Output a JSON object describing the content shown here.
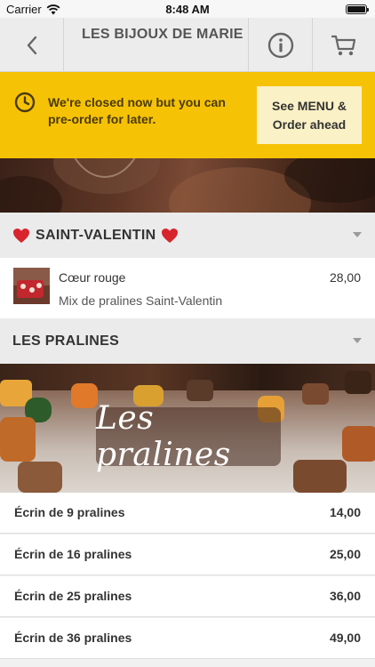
{
  "status_bar": {
    "carrier": "Carrier",
    "time": "8:48 AM"
  },
  "nav": {
    "title": "LES BIJOUX DE MARIE",
    "back_icon": "chevron-left-icon",
    "info_icon": "info-icon",
    "cart_icon": "cart-icon"
  },
  "banner": {
    "message": "We're closed now but you can pre-order for later.",
    "button_label": "See MENU & Order ahead",
    "icon": "clock-icon",
    "color": "#f6c205"
  },
  "sections": [
    {
      "title": "SAINT-VALENTIN",
      "icon": "heart-icon"
    },
    {
      "title": "LES PRALINES"
    }
  ],
  "featured_product": {
    "name": "Cœur rouge",
    "description": "Mix de pralines Saint-Valentin",
    "price": "28,00"
  },
  "praline_banner_label": "Les pralines",
  "products": [
    {
      "name": "Écrin de 9 pralines",
      "price": "14,00"
    },
    {
      "name": "Écrin de 16 pralines",
      "price": "25,00"
    },
    {
      "name": "Écrin de 25 pralines",
      "price": "36,00"
    },
    {
      "name": "Écrin de 36 pralines",
      "price": "49,00"
    }
  ]
}
